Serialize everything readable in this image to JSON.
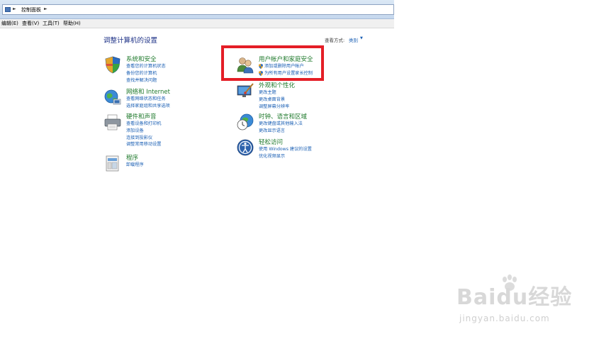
{
  "address": {
    "path": "控制面板"
  },
  "menu": [
    "编辑(E)",
    "查看(V)",
    "工具(T)",
    "帮助(H)"
  ],
  "page_title": "调整计算机的设置",
  "view_by": {
    "label": "查看方式:",
    "value": "类别"
  },
  "categories": {
    "system": {
      "title": "系统和安全",
      "links": [
        "查看您的计算机状态",
        "备份您的计算机",
        "查找并解决问题"
      ]
    },
    "network": {
      "title": "网络和 Internet",
      "links": [
        "查看网络状态和任务",
        "选择家庭组和共享选项"
      ]
    },
    "hardware": {
      "title": "硬件和声音",
      "links": [
        "查看设备和打印机",
        "添加设备",
        "连接到投影仪",
        "调整常用移动设置"
      ]
    },
    "programs": {
      "title": "程序",
      "links": [
        "卸载程序"
      ]
    },
    "users": {
      "title": "用户帐户和家庭安全",
      "links": [
        "添加或删除用户帐户",
        "为所有用户设置家长控制"
      ]
    },
    "appearance": {
      "title": "外观和个性化",
      "links": [
        "更改主题",
        "更改桌面背景",
        "调整屏幕分辨率"
      ]
    },
    "clock": {
      "title": "时钟、语言和区域",
      "links": [
        "更改键盘或其他输入法",
        "更改显示语言"
      ]
    },
    "ease": {
      "title": "轻松访问",
      "links": [
        "使用 Windows 建议的设置",
        "优化视频显示"
      ]
    }
  },
  "watermark": {
    "brand": "Baidu经验",
    "url": "jingyan.baidu.com"
  },
  "colors": {
    "highlight": "#e41e26",
    "category_title": "#1f7a2c",
    "link": "#1a5fb4"
  }
}
